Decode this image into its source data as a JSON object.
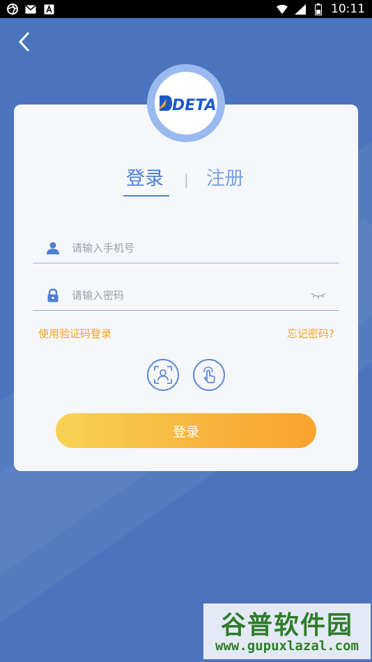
{
  "status_bar": {
    "time": "10:11",
    "left_icons": [
      "aperture-icon",
      "mail-icon",
      "a-icon"
    ],
    "right_icons": [
      "wifi-icon",
      "signal-icon",
      "battery-icon"
    ]
  },
  "header": {
    "back_icon": "chevron-left-icon"
  },
  "logo": {
    "text": "DETA"
  },
  "tabs": [
    {
      "label": "登录",
      "active": true
    },
    {
      "label": "注册",
      "active": false
    }
  ],
  "tab_divider": "|",
  "form": {
    "phone": {
      "placeholder": "请输入手机号",
      "value": ""
    },
    "password": {
      "placeholder": "请输入密码",
      "value": ""
    }
  },
  "links": {
    "sms_login": "使用验证码登录",
    "forgot_password": "忘记密码?"
  },
  "biometric": [
    "face-id-icon",
    "fingerprint-touch-icon"
  ],
  "login_button": {
    "label": "登录"
  },
  "watermark": {
    "title": "谷普软件园",
    "url": "www.gupuxlazal.com"
  },
  "colors": {
    "background": "#4a74bd",
    "accent": "#4a7fd6",
    "link": "#f0a41c",
    "button_start": "#f7d353",
    "button_end": "#f9a32c"
  }
}
